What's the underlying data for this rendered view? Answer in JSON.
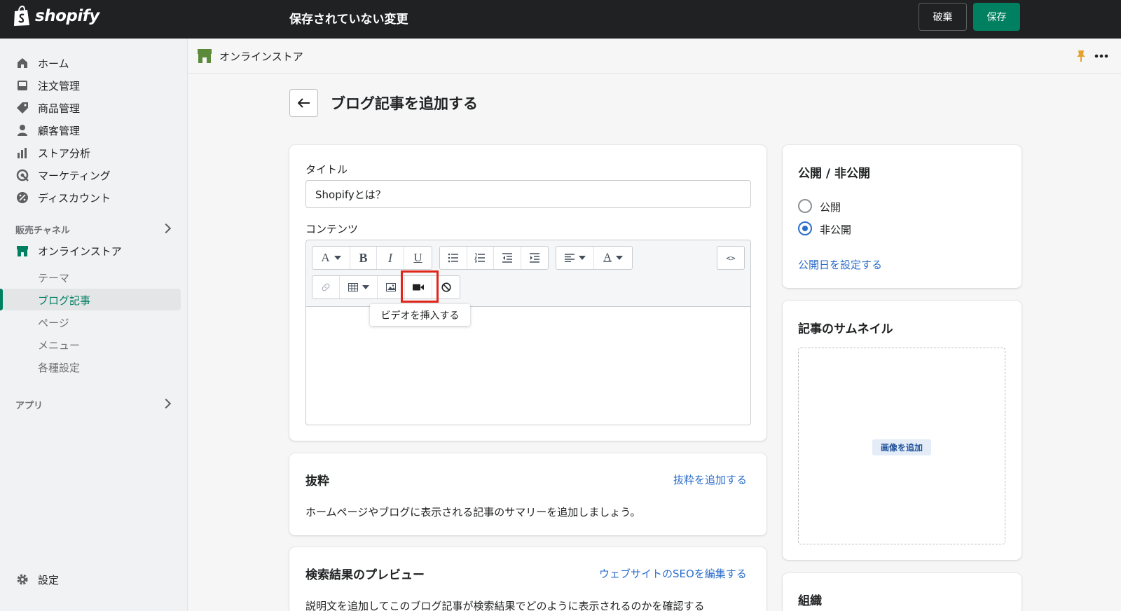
{
  "topbar": {
    "brand": "shopify",
    "unsaved_label": "保存されていない変更",
    "discard_label": "破棄",
    "save_label": "保存"
  },
  "sidebar": {
    "items": [
      {
        "label": "ホーム",
        "icon": "home-icon"
      },
      {
        "label": "注文管理",
        "icon": "inbox-icon"
      },
      {
        "label": "商品管理",
        "icon": "tag-icon"
      },
      {
        "label": "顧客管理",
        "icon": "person-icon"
      },
      {
        "label": "ストア分析",
        "icon": "bar-chart-icon"
      },
      {
        "label": "マーケティング",
        "icon": "target-icon"
      },
      {
        "label": "ディスカウント",
        "icon": "discount-icon"
      }
    ],
    "channels_heading": "販売チャネル",
    "online_store": "オンラインストア",
    "sub_items": [
      "テーマ",
      "ブログ記事",
      "ページ",
      "メニュー",
      "各種設定"
    ],
    "apps_heading": "アプリ",
    "settings": "設定"
  },
  "header": {
    "breadcrumb": "オンラインストア"
  },
  "page": {
    "title": "ブログ記事を追加する"
  },
  "form": {
    "title_label": "タイトル",
    "title_value": "Shopifyとは？",
    "content_label": "コンテンツ",
    "tooltip": "ビデオを挿入する",
    "html_toggle": "<>"
  },
  "excerpt": {
    "heading": "抜粋",
    "action": "抜粋を追加する",
    "description": "ホームページやブログに表示される記事のサマリーを追加しましょう。"
  },
  "seo": {
    "heading": "検索結果のプレビュー",
    "action": "ウェブサイトのSEOを編集する",
    "description": "説明文を追加してこのブログ記事が検索結果でどのように表示されるのかを確認する"
  },
  "visibility": {
    "heading": "公開 / 非公開",
    "option_public": "公開",
    "option_hidden": "非公開",
    "selected": "非公開",
    "set_date": "公開日を設定する"
  },
  "thumbnail": {
    "heading": "記事のサムネイル",
    "add_image": "画像を追加"
  },
  "organization": {
    "heading": "組織"
  },
  "colors": {
    "accent": "#008060",
    "link": "#2c6ecb",
    "highlight": "#e0261b"
  }
}
